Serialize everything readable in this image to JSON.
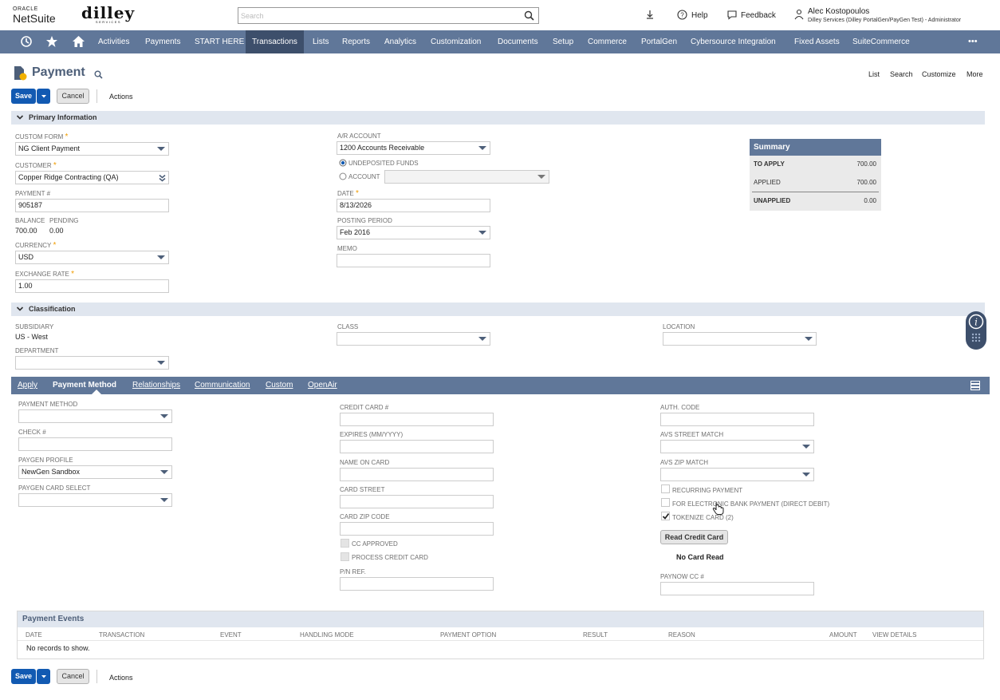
{
  "header": {
    "oracle_label": "ORACLE",
    "netsuite_label": "NetSuite",
    "company_logo_text": "dilley",
    "company_logo_sub": "SERVICES",
    "search_placeholder": "Search",
    "help_label": "Help",
    "feedback_label": "Feedback",
    "user_name": "Alec Kostopoulos",
    "user_role": "Dilley Services (Dilley PortalGen/PayGen Test) - Administrator"
  },
  "nav": {
    "items": [
      "Activities",
      "Payments",
      "START HERE",
      "Transactions",
      "Lists",
      "Reports",
      "Analytics",
      "Customization",
      "Documents",
      "Setup",
      "Commerce",
      "PortalGen",
      "Cybersource Integration",
      "Fixed Assets",
      "SuiteCommerce"
    ],
    "active": "Transactions",
    "more_label": "•••"
  },
  "page": {
    "title": "Payment",
    "save_label": "Save",
    "cancel_label": "Cancel",
    "actions_label": "Actions",
    "links": [
      "List",
      "Search",
      "Customize",
      "More"
    ]
  },
  "primary": {
    "section_label": "Primary Information",
    "custom_form_label": "CUSTOM FORM",
    "custom_form_value": "NG Client Payment",
    "customer_label": "CUSTOMER",
    "customer_value": "Copper Ridge Contracting (QA)",
    "payment_no_label": "PAYMENT #",
    "payment_no_value": "905187",
    "balance_label": "BALANCE",
    "balance_value": "700.00",
    "pending_label": "PENDING",
    "pending_value": "0.00",
    "currency_label": "CURRENCY",
    "currency_value": "USD",
    "exchange_rate_label": "EXCHANGE RATE",
    "exchange_rate_value": "1.00",
    "ar_account_label": "A/R ACCOUNT",
    "ar_account_value": "1200 Accounts Receivable",
    "undeposited_label": "UNDEPOSITED FUNDS",
    "account_label": "ACCOUNT",
    "date_label": "DATE",
    "date_value": "8/13/2026",
    "posting_period_label": "POSTING PERIOD",
    "posting_period_value": "Feb 2016",
    "memo_label": "MEMO",
    "memo_value": ""
  },
  "summary": {
    "title": "Summary",
    "to_apply_label": "TO APPLY",
    "to_apply_value": "700.00",
    "applied_label": "APPLIED",
    "applied_value": "700.00",
    "unapplied_label": "UNAPPLIED",
    "unapplied_value": "0.00"
  },
  "classification": {
    "section_label": "Classification",
    "subsidiary_label": "SUBSIDIARY",
    "subsidiary_value": "US - West",
    "department_label": "DEPARTMENT",
    "class_label": "CLASS",
    "location_label": "LOCATION"
  },
  "subtabs": {
    "items": [
      "Apply",
      "Payment Method",
      "Relationships",
      "Communication",
      "Custom",
      "OpenAir"
    ],
    "active": "Payment Method"
  },
  "payment_method": {
    "payment_method_label": "PAYMENT METHOD",
    "check_label": "CHECK #",
    "paygen_profile_label": "PAYGEN PROFILE",
    "paygen_profile_value": "NewGen Sandbox",
    "paygen_card_select_label": "PAYGEN CARD SELECT",
    "credit_card_label": "CREDIT CARD #",
    "expires_label": "EXPIRES (MM/YYYY)",
    "name_on_card_label": "NAME ON CARD",
    "card_street_label": "CARD STREET",
    "card_zip_label": "CARD ZIP CODE",
    "cc_approved_label": "CC APPROVED",
    "process_cc_label": "PROCESS CREDIT CARD",
    "pn_ref_label": "P/N REF.",
    "auth_code_label": "AUTH. CODE",
    "avs_street_label": "AVS STREET MATCH",
    "avs_zip_label": "AVS ZIP MATCH",
    "recurring_label": "RECURRING PAYMENT",
    "ebp_label": "FOR ELECTRONIC BANK PAYMENT (DIRECT DEBIT)",
    "tokenize_label": "TOKENIZE CARD (2)",
    "read_cc_label": "Read Credit Card",
    "no_card_read_label": "No Card Read",
    "paynow_label": "PAYNOW CC #"
  },
  "events": {
    "title": "Payment Events",
    "columns": [
      "DATE",
      "TRANSACTION",
      "EVENT",
      "HANDLING MODE",
      "PAYMENT OPTION",
      "RESULT",
      "REASON",
      "AMOUNT",
      "VIEW DETAILS"
    ],
    "empty_text": "No records to show."
  },
  "colors": {
    "nav_bg": "#607799",
    "nav_active": "#3d4f6b",
    "primary_button": "#125ab2",
    "section_bg": "#e0e6ef",
    "required": "#f09c00"
  }
}
